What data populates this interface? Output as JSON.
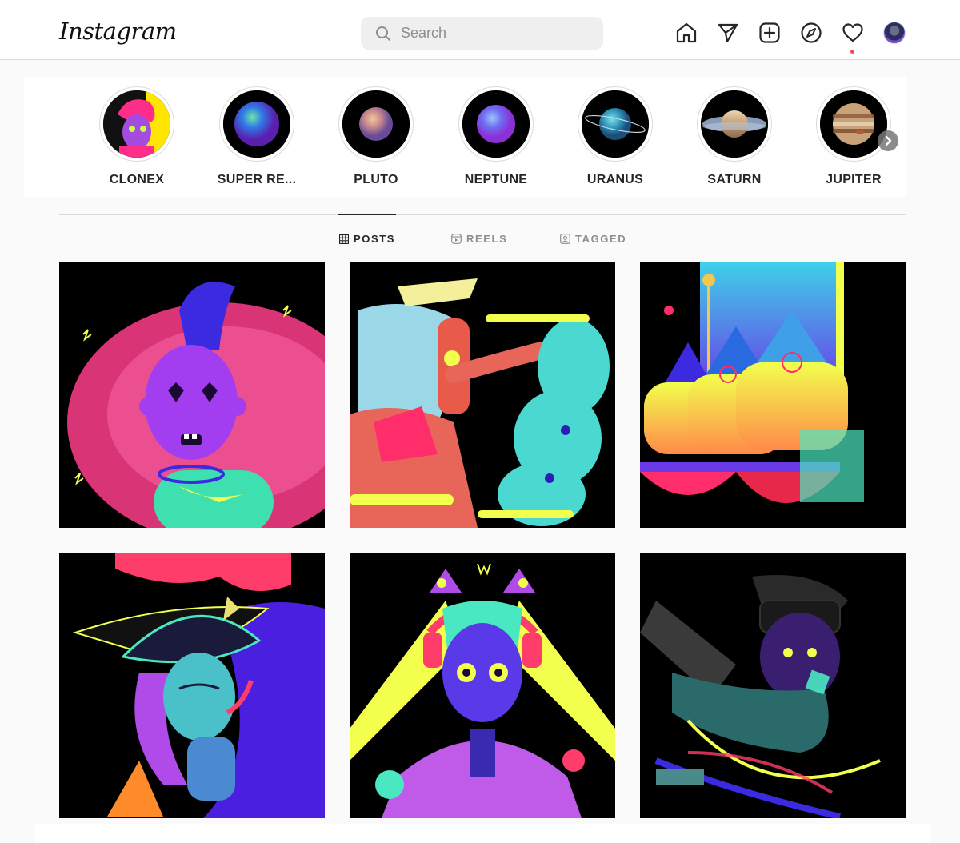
{
  "header": {
    "logo_text": "Instagram",
    "search": {
      "placeholder": "Search",
      "value": ""
    },
    "nav_icons": [
      "home-icon",
      "direct-send-icon",
      "new-post-icon",
      "explore-compass-icon",
      "activity-heart-icon",
      "profile-avatar"
    ],
    "notification_dot_color": "#ed4956"
  },
  "stories": [
    {
      "label": "CLONEX"
    },
    {
      "label": "SUPER RE..."
    },
    {
      "label": "PLUTO"
    },
    {
      "label": "NEPTUNE"
    },
    {
      "label": "URANUS"
    },
    {
      "label": "SATURN"
    },
    {
      "label": "JUPITER"
    }
  ],
  "tabs": [
    {
      "label": "POSTS",
      "icon": "grid-icon",
      "active": true
    },
    {
      "label": "REELS",
      "icon": "reels-icon",
      "active": false
    },
    {
      "label": "TAGGED",
      "icon": "tagged-icon",
      "active": false
    }
  ],
  "posts": [
    {
      "name": "mohawk-character-art"
    },
    {
      "name": "ghost-girl-art"
    },
    {
      "name": "triple-heads-art"
    },
    {
      "name": "witch-art"
    },
    {
      "name": "cat-ear-headphones-art"
    },
    {
      "name": "vr-headset-art"
    }
  ],
  "colors": {
    "text": "#262626",
    "muted": "#8e8e8e",
    "border": "#dbdbdb",
    "background": "#fafafa"
  }
}
